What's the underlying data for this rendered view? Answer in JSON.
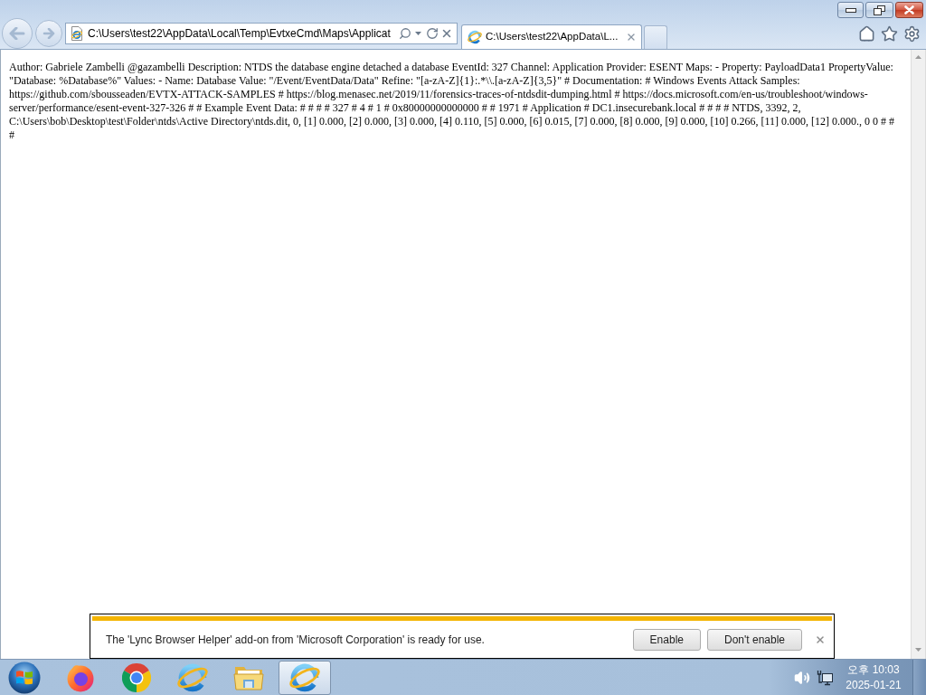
{
  "browser": {
    "address_bar": {
      "value": "C:\\Users\\test22\\AppData\\Local\\Temp\\EvtxeCmd\\Maps\\Applicat"
    },
    "tabs": [
      {
        "label": "C:\\Users\\test22\\AppData\\L...",
        "selected": true
      }
    ]
  },
  "page": {
    "lines": [
      "Author: Gabriele Zambelli @gazambelli Description: NTDS the database engine detached a database EventId: 327 Channel: Application Provider: ESENT Maps: - Property: PayloadData1 PropertyValue:",
      "\"Database: %Database%\" Values: - Name: Database Value: \"/Event/EventData/Data\" Refine: \"[a-zA-Z]{1}:.*\\\\.[a-zA-Z]{3,5}\" # Documentation: # Windows Events Attack Samples:",
      "https://github.com/sbousseaden/EVTX-ATTACK-SAMPLES # https://blog.menasec.net/2019/11/forensics-traces-of-ntdsdit-dumping.html # https://docs.microsoft.com/en-us/troubleshoot/windows-",
      "server/performance/esent-event-327-326 # # Example Event Data: # # # # 327 # 4 # 1 # 0x80000000000000 # # 1971 # Application # DC1.insecurebank.local # # # # NTDS, 3392, 2,",
      "C:\\Users\\bob\\Desktop\\test\\Folder\\ntds\\Active Directory\\ntds.dit, 0, [1] 0.000, [2] 0.000, [3] 0.000, [4] 0.110, [5] 0.000, [6] 0.015, [7] 0.000, [8] 0.000, [9] 0.000, [10] 0.266, [11] 0.000, [12] 0.000., 0 0 # #",
      "#"
    ]
  },
  "notification_bar": {
    "message": "The 'Lync Browser Helper' add-on from 'Microsoft Corporation' is ready for use.",
    "buttons": [
      "Enable",
      "Don't enable"
    ]
  },
  "taskbar": {
    "apps": [
      {
        "kind": "firefox",
        "selected": false
      },
      {
        "kind": "chrome",
        "selected": false
      },
      {
        "kind": "ie",
        "selected": false
      },
      {
        "kind": "explorer",
        "selected": false
      },
      {
        "kind": "ie",
        "selected": true
      }
    ],
    "clock": {
      "time": "오후 10:03",
      "date": "2025-01-21"
    }
  }
}
